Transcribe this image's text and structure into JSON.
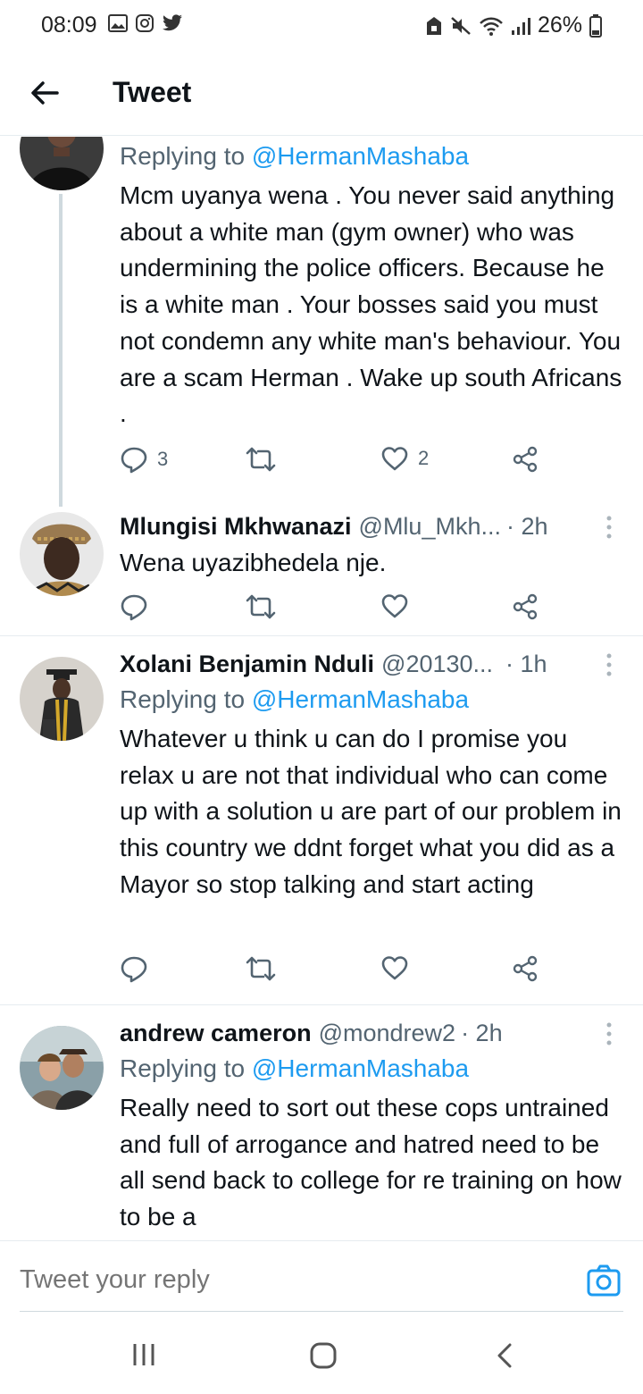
{
  "status": {
    "time": "08:09",
    "battery": "26%"
  },
  "header": {
    "title": "Tweet"
  },
  "tweets": [
    {
      "replying_prefix": "Replying to",
      "replying_handle": "@HermanMashaba",
      "text": "Mcm uyanya wena . You never said anything about a white man (gym owner) who was undermining the police officers. Because he is a white man . Your bosses said you must not condemn any white man's behaviour. You are a scam Herman . Wake up south Africans .",
      "reply_count": "3",
      "like_count": "2"
    },
    {
      "name": "Mlungisi Mkhwanazi",
      "handle": "@Mlu_Mkh...",
      "time": "· 2h",
      "text": "Wena uyazibhedela nje."
    },
    {
      "name": "Xolani Benjamin Nduli",
      "handle": "@20130...",
      "time": "· 1h",
      "replying_prefix": "Replying to",
      "replying_handle": "@HermanMashaba",
      "text": "Whatever u think u can do I promise you relax u are not that individual who can come up with a solution u are part of our problem in this country we ddnt forget what you did as a Mayor so stop talking and start acting"
    },
    {
      "name": "andrew cameron",
      "handle": "@mondrew2",
      "time": "· 2h",
      "replying_prefix": "Replying to",
      "replying_handle": "@HermanMashaba",
      "text": "Really need to sort out these cops untrained and full of arrogance and hatred need to be all send back to college for re training on how to be a"
    }
  ],
  "reply_bar": {
    "placeholder": "Tweet your reply"
  },
  "colors": {
    "accent": "#1d9bf0",
    "secondary_text": "#536471",
    "divider": "#e6ecf0"
  }
}
